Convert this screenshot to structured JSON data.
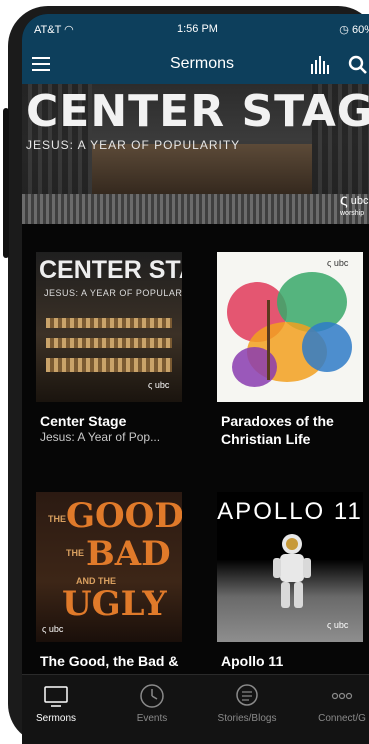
{
  "status_bar": {
    "carrier": "AT&T",
    "time": "1:56 PM",
    "battery": "60%"
  },
  "nav": {
    "title": "Sermons"
  },
  "hero": {
    "title": "CENTER STAGE",
    "subtitle": "JESUS: A YEAR OF POPULARITY",
    "logo": "ubc",
    "logo_sub": "worship"
  },
  "cards": [
    {
      "title": "Center Stage",
      "subtitle": "Jesus: A Year of Pop...",
      "art_title": "CENTER STAGE",
      "art_subtitle": "JESUS: A YEAR OF POPULARITY",
      "logo": "ubc"
    },
    {
      "title": "Paradoxes of the Christian Life",
      "subtitle": "",
      "logo": "ubc"
    },
    {
      "title": "The Good, the Bad & the Ugly",
      "subtitle": "",
      "art_the1": "THE",
      "art_good": "GOOD",
      "art_the2": "THE",
      "art_bad": "BAD",
      "art_and": "AND THE",
      "art_ugly": "UGLY",
      "logo": "ubc"
    },
    {
      "title": "Apollo 11",
      "subtitle": "",
      "art_title": "APOLLO 11",
      "logo": "ubc"
    }
  ],
  "tabs": [
    {
      "label": "Sermons",
      "icon": "tv-icon",
      "active": true
    },
    {
      "label": "Events",
      "icon": "clock-icon",
      "active": false
    },
    {
      "label": "Stories/Blogs",
      "icon": "chat-icon",
      "active": false
    },
    {
      "label": "Connect/G",
      "icon": "more-icon",
      "active": false
    }
  ],
  "colors": {
    "nav_bg": "#0d3f5c",
    "screen_bg": "#060606",
    "tab_active": "#ffffff",
    "tab_inactive": "#8a8a8a"
  }
}
